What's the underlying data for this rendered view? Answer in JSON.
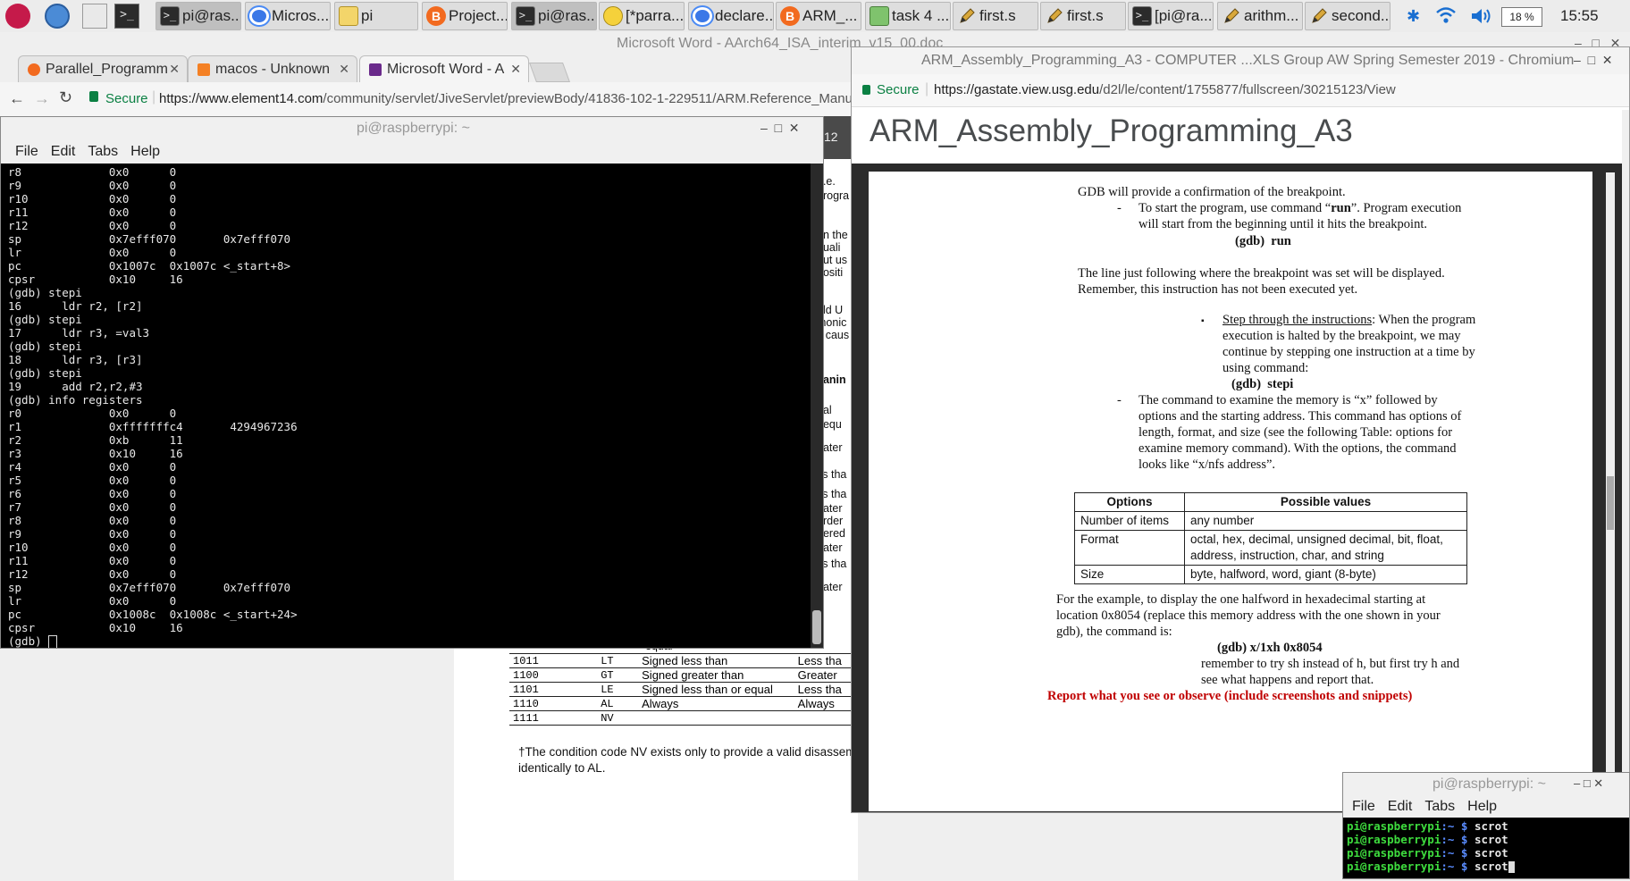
{
  "taskbar": {
    "tasks": [
      {
        "label": "pi@ras...",
        "icon": "terminal-icon"
      },
      {
        "label": "Micros...",
        "icon": "chromium-icon"
      },
      {
        "label": "pi",
        "icon": "folder-icon"
      },
      {
        "label": "Project...",
        "icon": "brave-icon"
      },
      {
        "label": "pi@ras...",
        "icon": "terminal-icon"
      },
      {
        "label": "[*parra...",
        "icon": "face-icon"
      },
      {
        "label": "declare...",
        "icon": "chromium-icon"
      },
      {
        "label": "ARM_...",
        "icon": "brave-icon"
      },
      {
        "label": "task 4 ...",
        "icon": "image-icon"
      },
      {
        "label": "first.s",
        "icon": "pencil-icon"
      },
      {
        "label": "first.s",
        "icon": "pencil-icon"
      },
      {
        "label": "[pi@ra...",
        "icon": "terminal-icon"
      },
      {
        "label": "arithm...",
        "icon": "pencil-icon"
      },
      {
        "label": "second...",
        "icon": "pencil-icon"
      }
    ],
    "battery": "18 %",
    "clock": "15:55"
  },
  "back_browser": {
    "title": "Microsoft Word - AArch64_ISA_interim_v15_00.doc",
    "tabs": [
      {
        "label": "Parallel_Programm",
        "icon": "brave-icon"
      },
      {
        "label": "macos - Unknown",
        "icon": "stackoverflow-icon"
      },
      {
        "label": "Microsoft Word - A",
        "icon": "element14-icon"
      }
    ],
    "secure": "Secure",
    "url_host": "https://www.element14.com",
    "url_path": "/community/servlet/JiveServlet/previewBody/41836-102-1-229511/ARM.Reference_Manual.pdf",
    "page_number": "12",
    "side_fragments": [
      "(i.e.",
      "progra",
      "en the",
      "quali",
      "out us",
      "positi",
      "old U",
      "monic",
      "y caus",
      "eanin",
      "ual",
      "t equ",
      "eater",
      "ss tha",
      "ss tha",
      "eater",
      "order",
      "dered",
      "eater",
      "ss tha",
      "eater"
    ],
    "cc_table": {
      "partial_row": "equal",
      "rows": [
        {
          "code": "1011",
          "mnemonic": "LT",
          "meaning": "Signed less than",
          "other": "Less tha"
        },
        {
          "code": "1100",
          "mnemonic": "GT",
          "meaning": "Signed greater than",
          "other": "Greater"
        },
        {
          "code": "1101",
          "mnemonic": "LE",
          "meaning": "Signed less than or equal",
          "other": "Less tha"
        },
        {
          "code": "1110",
          "mnemonic": "AL",
          "meaning": "Always",
          "other": "Always"
        },
        {
          "code": "1111",
          "mnemonic": "NV",
          "meaning": "",
          "other": ""
        }
      ]
    },
    "footnote_1": "†The condition code NV exists only to provide a valid disassem",
    "footnote_2": "identically to AL."
  },
  "terminal_main": {
    "title": "pi@raspberrypi: ~",
    "menu": [
      "File",
      "Edit",
      "Tabs",
      "Help"
    ],
    "lines": [
      "r8             0x0      0",
      "r9             0x0      0",
      "r10            0x0      0",
      "r11            0x0      0",
      "r12            0x0      0",
      "sp             0x7efff070       0x7efff070",
      "lr             0x0      0",
      "pc             0x1007c  0x1007c <_start+8>",
      "cpsr           0x10     16",
      "(gdb) stepi",
      "16      ldr r2, [r2]",
      "(gdb) stepi",
      "17      ldr r3, =val3",
      "(gdb) stepi",
      "18      ldr r3, [r3]",
      "(gdb) stepi",
      "19      add r2,r2,#3",
      "(gdb) info registers",
      "r0             0x0      0",
      "r1             0xfffffffc4       4294967236",
      "r2             0xb      11",
      "r3             0x10     16",
      "r4             0x0      0",
      "r5             0x0      0",
      "r6             0x0      0",
      "r7             0x0      0",
      "r8             0x0      0",
      "r9             0x0      0",
      "r10            0x0      0",
      "r11            0x0      0",
      "r12            0x0      0",
      "sp             0x7efff070       0x7efff070",
      "lr             0x0      0",
      "pc             0x1008c  0x1008c <_start+24>",
      "cpsr           0x10     16",
      "(gdb) "
    ]
  },
  "front_browser": {
    "title": "ARM_Assembly_Programming_A3 - COMPUTER ...XLS Group AW Spring Semester 2019 - Chromium",
    "secure": "Secure",
    "url_host": "https://gastate.view.usg.edu",
    "url_path": "/d2l/le/content/1755877/fullscreen/30215123/View",
    "page_heading": "ARM_Assembly_Programming_A3",
    "doc": {
      "p1": "GDB will provide a confirmation of the breakpoint.",
      "dash1": "-",
      "bullet1_a": "To start the program, use command “",
      "bullet1_b": "run",
      "bullet1_c": "”. Program execution",
      "bullet1_line2": "will start from the beginning until it hits the breakpoint.",
      "cmd_run": "(gdb)  run",
      "p2_l1": "The line just following where the breakpoint was set will be displayed.",
      "p2_l2": "Remember, this instruction has not been executed yet.",
      "bullet_mark": "▪",
      "step_title": "Step through the instructions",
      "step_l1": ": When the program",
      "step_l2": "execution is halted by the breakpoint, we may",
      "step_l3": "continue by stepping one instruction at a time by",
      "step_l4": "using command:",
      "cmd_stepi": "(gdb)  stepi",
      "dash2": "-",
      "x_l1": "The command to examine the memory is “x” followed by",
      "x_l2": "options and the starting address. This command has options of",
      "x_l3": "length, format, and size (see the following Table: options for",
      "x_l4": "examine memory command). With the options, the command",
      "x_l5": "looks like “x/nfs address”.",
      "table_headers": [
        "Options",
        "Possible values"
      ],
      "table_rows": [
        {
          "option": "Number of items",
          "values": "any number"
        },
        {
          "option": "Format",
          "values": "octal, hex, decimal, unsigned decimal, bit, float, address, instruction, char, and string"
        },
        {
          "option": "Size",
          "values": "byte, halfword, word, giant (8-byte)"
        }
      ],
      "ex_l1": "For the example, to display the one halfword in hexadecimal starting at",
      "ex_l2": "location 0x8054 (replace this memory address with the one shown in your",
      "ex_l3": "gdb), the command is:",
      "cmd_x": "(gdb) x/1xh 0x8054",
      "rem_l1": "remember to try sh instead of h, but first try h and",
      "rem_l2": "see what happens and report that.",
      "report": "Report what you see or observe (include screenshots and snippets)"
    }
  },
  "terminal_small": {
    "title": "pi@raspberrypi: ~",
    "menu": [
      "File",
      "Edit",
      "Tabs",
      "Help"
    ],
    "prompt": "pi@raspberrypi",
    "path": ":~ $",
    "commands": [
      "scrot",
      "scrot",
      "scrot",
      "scrot"
    ]
  }
}
